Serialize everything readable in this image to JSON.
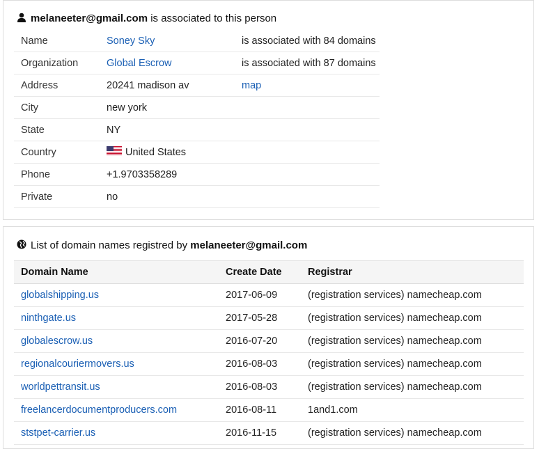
{
  "person_panel": {
    "email": "melaneeter@gmail.com",
    "title_suffix": " is associated to this person",
    "rows": [
      {
        "label": "Name",
        "value": "Soney Sky",
        "value_is_link": true,
        "extra": "is associated with 84 domains"
      },
      {
        "label": "Organization",
        "value": "Global Escrow",
        "value_is_link": true,
        "extra": "is associated with 87 domains"
      },
      {
        "label": "Address",
        "value": "20241 madison av",
        "value_is_link": false,
        "extra": "map",
        "extra_is_link": true
      },
      {
        "label": "City",
        "value": "new york"
      },
      {
        "label": "State",
        "value": "NY"
      },
      {
        "label": "Country",
        "value": "United States",
        "flag": "us-flag-icon"
      },
      {
        "label": "Phone",
        "value": "+1.9703358289"
      },
      {
        "label": "Private",
        "value": "no"
      }
    ]
  },
  "domains_panel": {
    "title_prefix": "List of domain names registred by ",
    "email": "melaneeter@gmail.com",
    "columns": [
      "Domain Name",
      "Create Date",
      "Registrar"
    ],
    "rows": [
      {
        "domain": "globalshipping.us",
        "date": "2017-06-09",
        "registrar": "(registration services) namecheap.com"
      },
      {
        "domain": "ninthgate.us",
        "date": "2017-05-28",
        "registrar": "(registration services) namecheap.com"
      },
      {
        "domain": "globalescrow.us",
        "date": "2016-07-20",
        "registrar": "(registration services) namecheap.com"
      },
      {
        "domain": "regionalcouriermovers.us",
        "date": "2016-08-03",
        "registrar": "(registration services) namecheap.com"
      },
      {
        "domain": "worldpettransit.us",
        "date": "2016-08-03",
        "registrar": "(registration services) namecheap.com"
      },
      {
        "domain": "freelancerdocumentproducers.com",
        "date": "2016-08-11",
        "registrar": "1and1.com"
      },
      {
        "domain": "ststpet-carrier.us",
        "date": "2016-11-15",
        "registrar": "(registration services) namecheap.com"
      }
    ]
  },
  "colors": {
    "link": "#1a5fb4",
    "header_bg": "#f5f5f5",
    "border": "#dddddd"
  },
  "icons": {
    "person_title": "user-icon",
    "domains_title": "globe-icon"
  }
}
